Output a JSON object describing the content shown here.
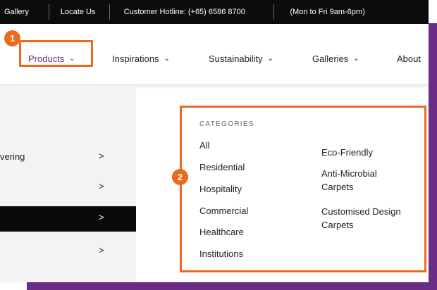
{
  "topbar": {
    "items": [
      "Gallery",
      "Locate Us",
      "Customer Hotline: (+65) 6586 8700",
      "(Mon to Fri 9am-6pm)"
    ]
  },
  "nav": {
    "items": [
      "Products",
      "Inspirations",
      "Sustainability",
      "Galleries",
      "About"
    ]
  },
  "badges": {
    "one": "1",
    "two": "2"
  },
  "left_menu": {
    "items": [
      {
        "label": "",
        "arrow": ""
      },
      {
        "label": "vering",
        "arrow": ">"
      },
      {
        "label": "",
        "arrow": ">"
      },
      {
        "label": "",
        "arrow": ">"
      },
      {
        "label": "",
        "arrow": ">"
      }
    ]
  },
  "categories": {
    "heading": "CATEGORIES",
    "col1": [
      "All",
      "Residential",
      "Hospitality",
      "Commercial",
      "Healthcare",
      "Institutions"
    ],
    "col2": [
      "Eco-Friendly",
      "Anti-Microbial\nCarpets",
      "Customised Design\nCarpets"
    ]
  },
  "colors": {
    "accent": "#ea6b1f",
    "brand_purple": "#6a2c84",
    "topbar": "#0c0c0c"
  }
}
